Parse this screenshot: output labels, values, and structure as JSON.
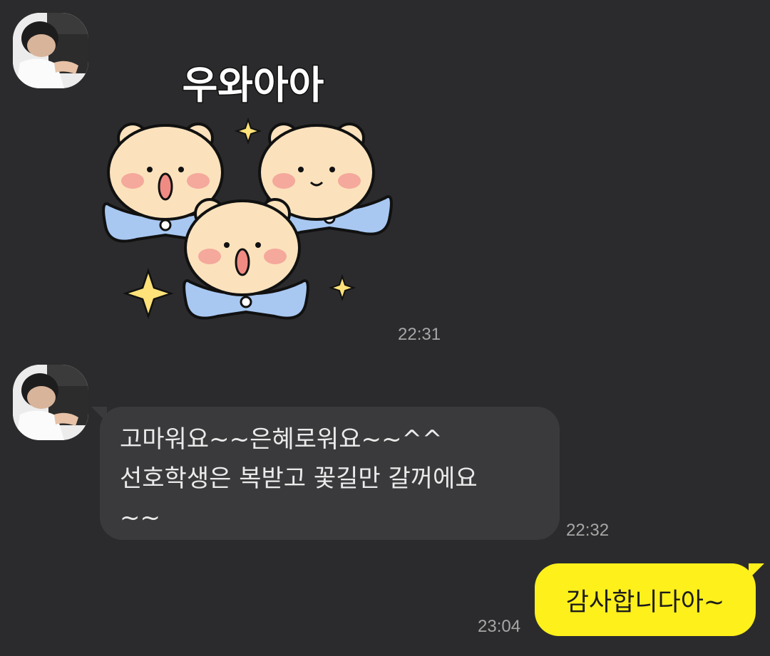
{
  "messages": [
    {
      "sender_name": "",
      "avatar": "profile-photo",
      "type": "sticker",
      "sticker": {
        "text": "우와아아",
        "description": "three-bears-sticker"
      },
      "time": "22:31"
    },
    {
      "sender_name": "",
      "avatar": "profile-photo",
      "type": "text",
      "lines": [
        "고마워요~~은혜로워요~~^^",
        "선호학생은 복받고 꽃길만 갈꺼에요",
        "~~"
      ],
      "time": "22:32"
    },
    {
      "direction": "outgoing",
      "type": "text",
      "text": "감사합니다아~",
      "time": "23:04"
    }
  ],
  "colors": {
    "background": "#2b2b2d",
    "incoming_bubble": "#3a3a3c",
    "outgoing_bubble": "#fef01b",
    "timestamp": "#a6a6a6"
  }
}
